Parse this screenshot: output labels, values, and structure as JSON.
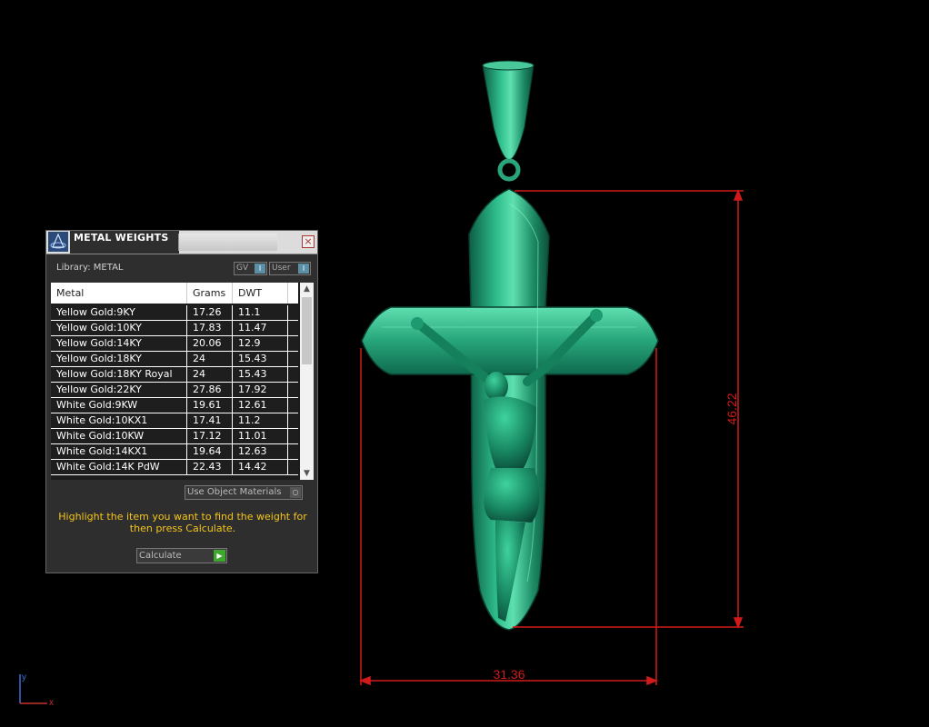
{
  "panel": {
    "title": "METAL WEIGHTS",
    "close": "×",
    "library_label": "Library: METAL",
    "toggles": [
      {
        "label": "GV",
        "knob": "I"
      },
      {
        "label": "User",
        "knob": "I"
      }
    ],
    "columns": [
      "Metal",
      "Grams",
      "DWT"
    ],
    "rows": [
      {
        "metal": "Yellow Gold:9KY",
        "grams": "17.26",
        "dwt": "11.1"
      },
      {
        "metal": "Yellow Gold:10KY",
        "grams": "17.83",
        "dwt": "11.47"
      },
      {
        "metal": "Yellow Gold:14KY",
        "grams": "20.06",
        "dwt": "12.9"
      },
      {
        "metal": "Yellow Gold:18KY",
        "grams": "24",
        "dwt": "15.43"
      },
      {
        "metal": "Yellow Gold:18KY Royal",
        "grams": "24",
        "dwt": "15.43"
      },
      {
        "metal": "Yellow Gold:22KY",
        "grams": "27.86",
        "dwt": "17.92"
      },
      {
        "metal": "White Gold:9KW",
        "grams": "19.61",
        "dwt": "12.61"
      },
      {
        "metal": "White Gold:10KX1",
        "grams": "17.41",
        "dwt": "11.2"
      },
      {
        "metal": "White Gold:10KW",
        "grams": "17.12",
        "dwt": "11.01"
      },
      {
        "metal": "White Gold:14KX1",
        "grams": "19.64",
        "dwt": "12.63"
      },
      {
        "metal": "White Gold:14K PdW",
        "grams": "22.43",
        "dwt": "14.42"
      }
    ],
    "use_object_materials": "Use Object Materials",
    "hint": "Highlight the item you want to find the weight for then press Calculate.",
    "calculate_label": "Calculate"
  },
  "viewport": {
    "dimension_height": "46.22",
    "dimension_width": "31.36",
    "axis_y": "y",
    "axis_x": "x",
    "model_color": "#1f9a72",
    "dimension_color": "#d11a1a",
    "hint_color": "#f5c518"
  }
}
